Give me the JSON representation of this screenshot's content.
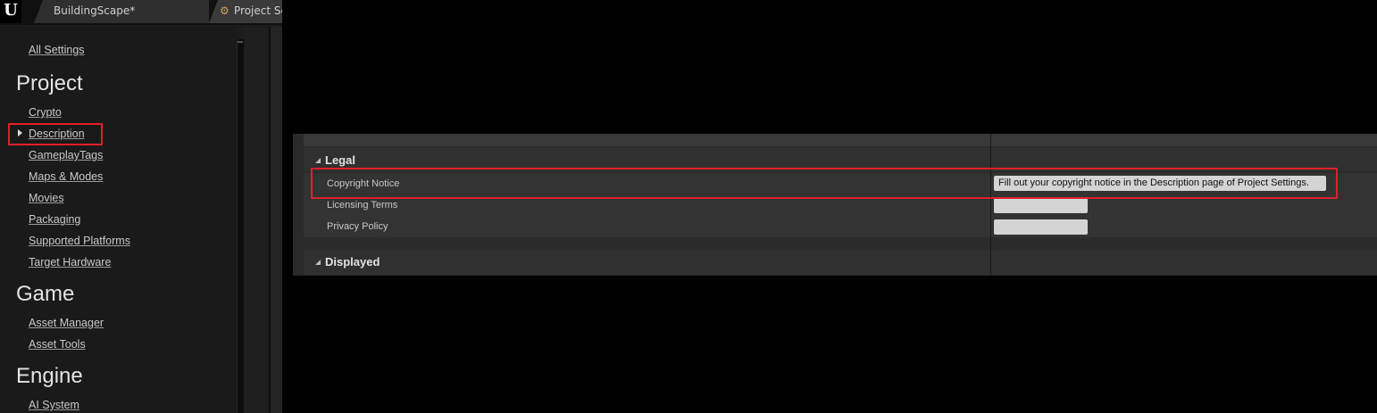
{
  "tabs": {
    "logo": "U",
    "level_tab_label": "BuildingScape*",
    "project_tab_label": "Project Settings"
  },
  "nav": {
    "all_settings": "All Settings",
    "sections": [
      {
        "heading": "Project",
        "items": [
          "Crypto",
          "Description",
          "GameplayTags",
          "Maps & Modes",
          "Movies",
          "Packaging",
          "Supported Platforms",
          "Target Hardware"
        ]
      },
      {
        "heading": "Game",
        "items": [
          "Asset Manager",
          "Asset Tools"
        ]
      },
      {
        "heading": "Engine",
        "items": [
          "AI System"
        ]
      }
    ],
    "selected_item": "Description"
  },
  "details": {
    "categories": {
      "legal": "Legal",
      "displayed": "Displayed"
    },
    "properties": [
      {
        "label": "Copyright Notice",
        "value": "Fill out your copyright notice in the Description page of Project Settings."
      },
      {
        "label": "Licensing Terms",
        "value": ""
      },
      {
        "label": "Privacy Policy",
        "value": ""
      }
    ]
  },
  "colors": {
    "highlight": "#e0202a",
    "panel_bg": "#2b2b2b",
    "nav_bg": "#1a1a1a"
  }
}
